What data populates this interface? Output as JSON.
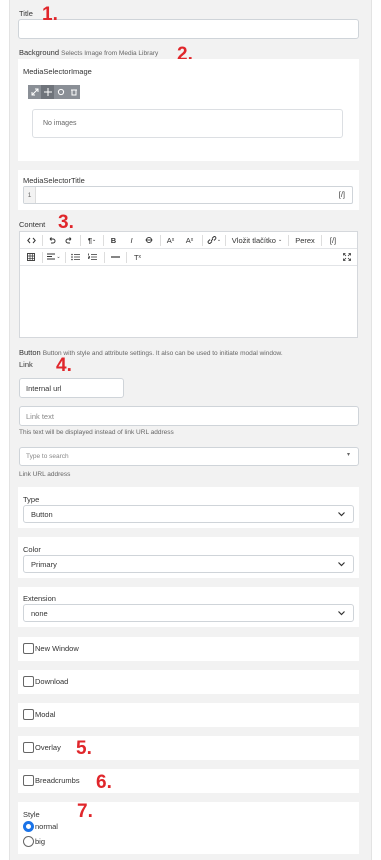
{
  "title_field": {
    "label": "Title",
    "value": ""
  },
  "background": {
    "label": "Background",
    "help": "Selects Image from Media Library",
    "media_selector_label": "MediaSelectorImage",
    "no_images_text": "No images",
    "media_title_label": "MediaSelectorTitle",
    "line_number": "1",
    "expand_icon_text": "[/]"
  },
  "content": {
    "label": "Content",
    "toolbar_row1": [
      "<>",
      "↶",
      "↷",
      "¶",
      "B",
      "I",
      "S",
      "A",
      "A",
      "🔗",
      "Vložit tlačítko",
      "Perex",
      "[/]"
    ],
    "insert_button_label": "Vložit tlačítko",
    "perex_label": "Perex",
    "source_label": "[/]"
  },
  "button_section": {
    "label": "Button",
    "help": "Button with style and attribute settings. It also can be used to initiate modal window.",
    "link_label": "Link",
    "link_type_value": "Internal url",
    "link_text_placeholder": "Link text",
    "link_text_help": "This text will be displayed instead of link URL address",
    "search_placeholder": "Type to search",
    "search_help": "Link URL address"
  },
  "type_field": {
    "label": "Type",
    "value": "Button"
  },
  "color_field": {
    "label": "Color",
    "value": "Primary"
  },
  "extension_field": {
    "label": "Extension",
    "value": "none"
  },
  "checkboxes": {
    "new_window": "New Window",
    "download": "Download",
    "modal": "Modal",
    "overlay": "Overlay",
    "breadcrumbs": "Breadcrumbs"
  },
  "style_field": {
    "label": "Style",
    "options": [
      "normal",
      "big"
    ],
    "selected": "normal"
  },
  "annotations": [
    "1.",
    "2.",
    "3.",
    "4.",
    "5.",
    "6.",
    "7."
  ],
  "colors": {
    "annotation": "#e0262b",
    "radio_selected": "#1a73e8",
    "background": "#f2f2f2"
  }
}
